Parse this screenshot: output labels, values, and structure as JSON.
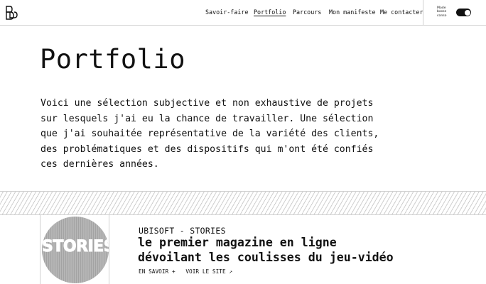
{
  "header": {
    "nav": [
      {
        "label": "Savoir-faire",
        "active": false
      },
      {
        "label": "Portfolio",
        "active": true
      },
      {
        "label": "Parcours",
        "active": false
      },
      {
        "label": "Mon manifeste",
        "active": false
      },
      {
        "label": "Me contacter",
        "active": false
      }
    ],
    "mode_label_lines": [
      "Mode",
      "basse",
      "conso"
    ],
    "toggle_on": true
  },
  "main": {
    "title": "Portfolio",
    "intro_lines": [
      "Voici une sélection subjective et non exhaustive de projets",
      "sur lesquels j'ai eu la chance de travailler. Une sélection",
      "que j'ai souhaitée représentative de la variété des clients,",
      "des problématiques et des dispositifs qui m'ont été confiés",
      "ces dernières années."
    ]
  },
  "project": {
    "thumb_text": "STORIES",
    "client": "UBISOFT - STORIES",
    "headline_lines": [
      "le premier magazine en ligne",
      "dévoilant les coulisses du jeu-vidéo"
    ],
    "learn_more": "EN SAVOIR +",
    "visit": "VOIR LE SITE ↗"
  },
  "colors": {
    "text": "#111111",
    "border": "#d0d0d0",
    "thumb_gray": "#b5b5b5"
  }
}
